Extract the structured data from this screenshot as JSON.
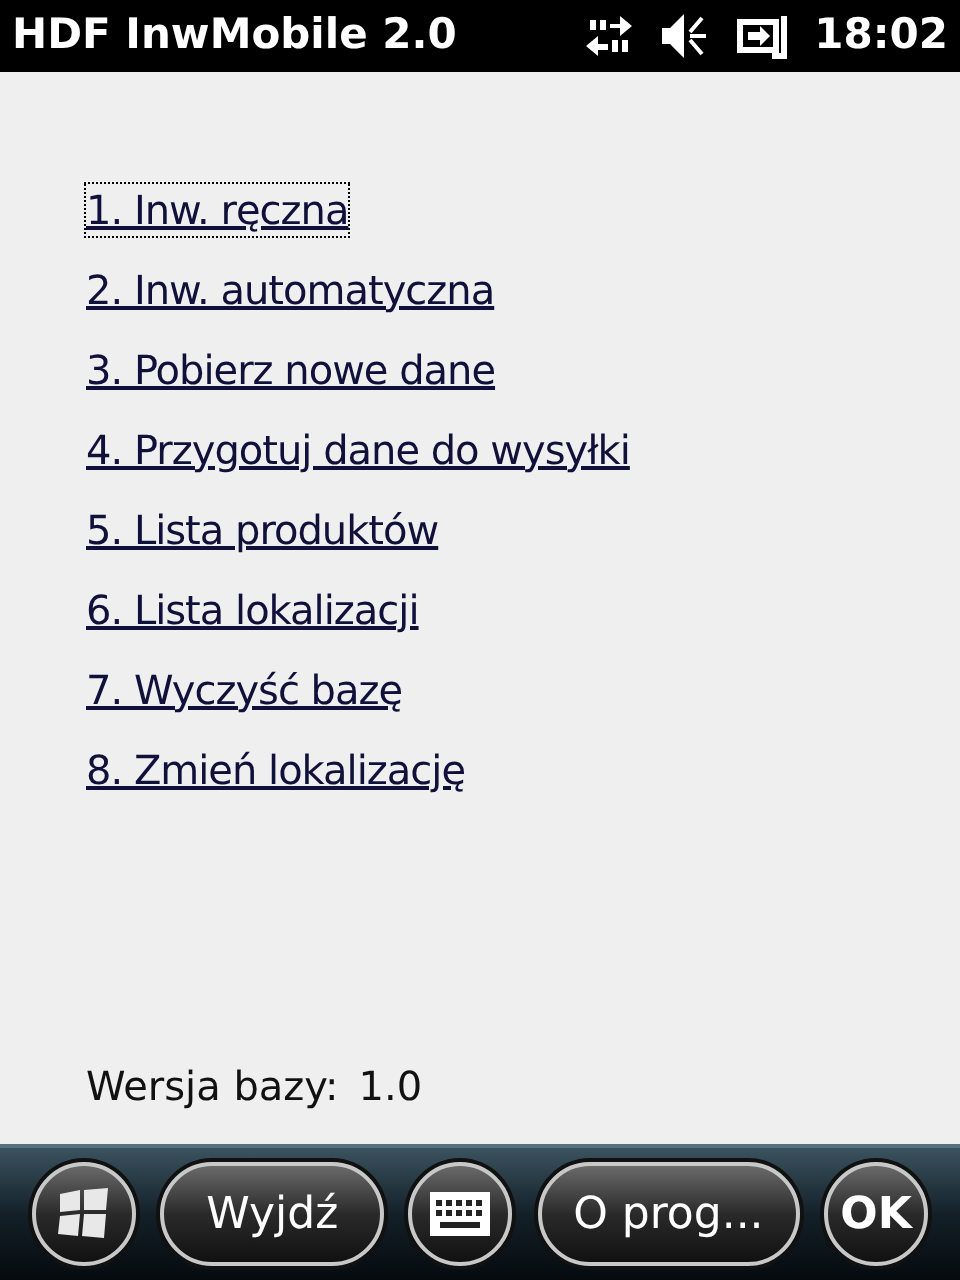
{
  "title_bar": {
    "title": "HDF InwMobile 2.0",
    "time": "18:02"
  },
  "menu": [
    {
      "label": "1. Inw. ręczna",
      "focused": true
    },
    {
      "label": "2. Inw. automatyczna",
      "focused": false
    },
    {
      "label": "3. Pobierz nowe dane",
      "focused": false
    },
    {
      "label": "4. Przygotuj dane do wysyłki",
      "focused": false
    },
    {
      "label": "5. Lista produktów",
      "focused": false
    },
    {
      "label": "6. Lista lokalizacji",
      "focused": false
    },
    {
      "label": "7. Wyczyść bazę",
      "focused": false
    },
    {
      "label": "8. Zmień lokalizację",
      "focused": false
    }
  ],
  "version": {
    "label": "Wersja bazy:",
    "value": "1.0"
  },
  "softkeys": [
    {
      "kind": "start"
    },
    {
      "kind": "text",
      "label": "Wyjdź"
    },
    {
      "kind": "keyboard"
    },
    {
      "kind": "text",
      "label": "O prog..."
    },
    {
      "kind": "ok",
      "label": "OK"
    }
  ]
}
